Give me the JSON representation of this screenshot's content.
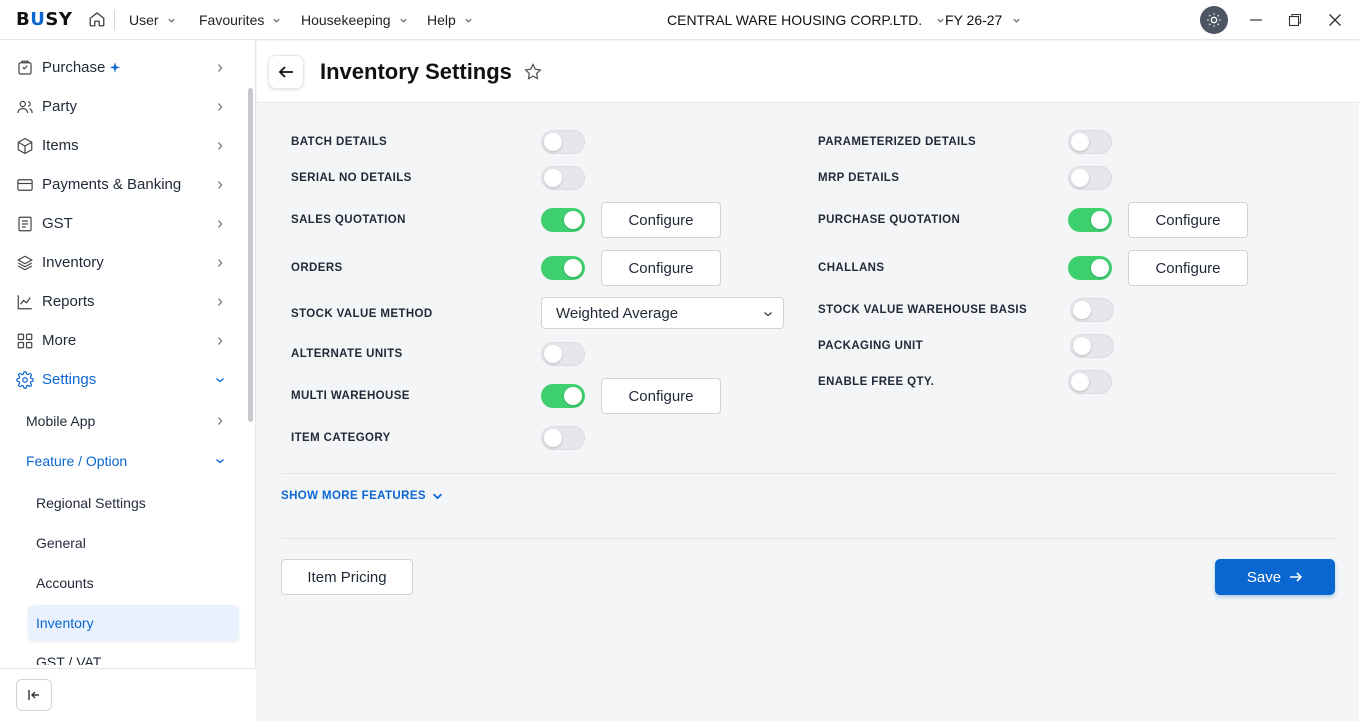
{
  "topbar": {
    "logo": {
      "b": "B",
      "u": "U",
      "rest": "SY"
    },
    "menus": [
      {
        "label": "User"
      },
      {
        "label": "Favourites"
      },
      {
        "label": "Housekeeping"
      },
      {
        "label": "Help"
      }
    ],
    "company": "CENTRAL WARE HOUSING CORP.LTD.",
    "fy": "FY 26-27"
  },
  "sidebar": {
    "items": [
      {
        "label": "Purchase",
        "icon": "purchase-icon",
        "badge_icon": "sparkle-icon"
      },
      {
        "label": "Party",
        "icon": "party-icon"
      },
      {
        "label": "Items",
        "icon": "box-icon"
      },
      {
        "label": "Payments & Banking",
        "icon": "wallet-icon"
      },
      {
        "label": "GST",
        "icon": "document-icon"
      },
      {
        "label": "Inventory",
        "icon": "layers-icon"
      },
      {
        "label": "Reports",
        "icon": "chart-icon"
      },
      {
        "label": "More",
        "icon": "grid-icon"
      },
      {
        "label": "Settings",
        "icon": "gear-icon"
      }
    ],
    "sub_items": {
      "mobile_app": "Mobile App",
      "feature_option": "Feature / Option",
      "regional": "Regional Settings",
      "general": "General",
      "accounts": "Accounts",
      "inventory": "Inventory",
      "gst_vat": "GST / VAT"
    },
    "accent_color": "#0a66d1"
  },
  "page": {
    "title": "Inventory Settings"
  },
  "settings": {
    "batch_details": {
      "label": "BATCH DETAILS",
      "enabled": false
    },
    "serial_no_details": {
      "label": "SERIAL NO DETAILS",
      "enabled": false
    },
    "sales_quotation": {
      "label": "SALES QUOTATION",
      "enabled": true,
      "button": "Configure"
    },
    "orders": {
      "label": "ORDERS",
      "enabled": true,
      "button": "Configure"
    },
    "stock_value_method": {
      "label": "STOCK VALUE METHOD",
      "value": "Weighted Average"
    },
    "alternate_units": {
      "label": "ALTERNATE UNITS",
      "enabled": false
    },
    "multi_warehouse": {
      "label": "MULTI WAREHOUSE",
      "enabled": true,
      "button": "Configure"
    },
    "item_category": {
      "label": "ITEM CATEGORY",
      "enabled": false
    },
    "parameterized_details": {
      "label": "PARAMETERIZED DETAILS",
      "enabled": false
    },
    "mrp_details": {
      "label": "MRP DETAILS",
      "enabled": false
    },
    "purchase_quotation": {
      "label": "PURCHASE QUOTATION",
      "enabled": true,
      "button": "Configure"
    },
    "challans": {
      "label": "CHALLANS",
      "enabled": true,
      "button": "Configure"
    },
    "stock_value_warehouse_basis": {
      "label": "STOCK VALUE WAREHOUSE BASIS",
      "enabled": false
    },
    "packaging_unit": {
      "label": "PACKAGING UNIT",
      "enabled": false
    },
    "enable_free_qty": {
      "label": "ENABLE FREE QTY.",
      "enabled": false
    }
  },
  "footer": {
    "show_more": "SHOW MORE FEATURES",
    "item_pricing": "Item Pricing",
    "save": "Save"
  },
  "colors": {
    "toggle_on": "#3ed06f",
    "primary": "#0a66d1"
  }
}
